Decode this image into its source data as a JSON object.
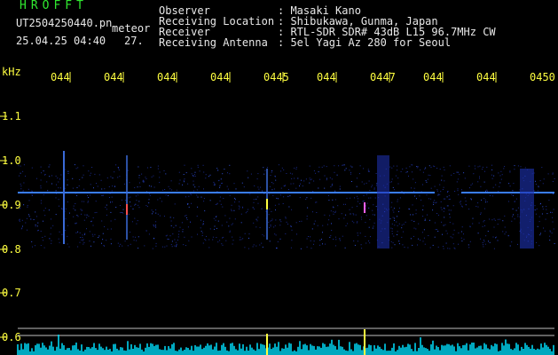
{
  "header": {
    "app": "HROFFT",
    "file": "UT2504250440.pn",
    "meteor": "meteor",
    "datetime": "25.04.25 04:40",
    "count": "27."
  },
  "info": [
    {
      "label": "Observer",
      "value": ": Masaki Kano"
    },
    {
      "label": "Receiving Location",
      "value": ": Shibukawa, Gunma, Japan"
    },
    {
      "label": "Receiver",
      "value": ": RTL-SDR SDR# 43dB L15 96.7MHz CW"
    },
    {
      "label": "Receiving Antenna",
      "value": ": 5el Yagi Az 280 for Seoul"
    }
  ],
  "axis": {
    "unit": "kHz",
    "time_ticks": [
      "044",
      "044",
      "044",
      "044",
      "0445",
      "044",
      "0447",
      "044",
      "044",
      "0450"
    ],
    "freq_ticks": [
      "1.1",
      "1.0",
      "0.9",
      "0.8",
      "0.7",
      "0.6"
    ]
  },
  "colors": {
    "background": "#000000",
    "label": "#ffff40",
    "info": "#e8e8e8",
    "app": "#30e830",
    "carrier": "#3a7dff",
    "noise": "#1a2a8c",
    "power": "#00e0ff",
    "peak": "#ffff40"
  }
}
